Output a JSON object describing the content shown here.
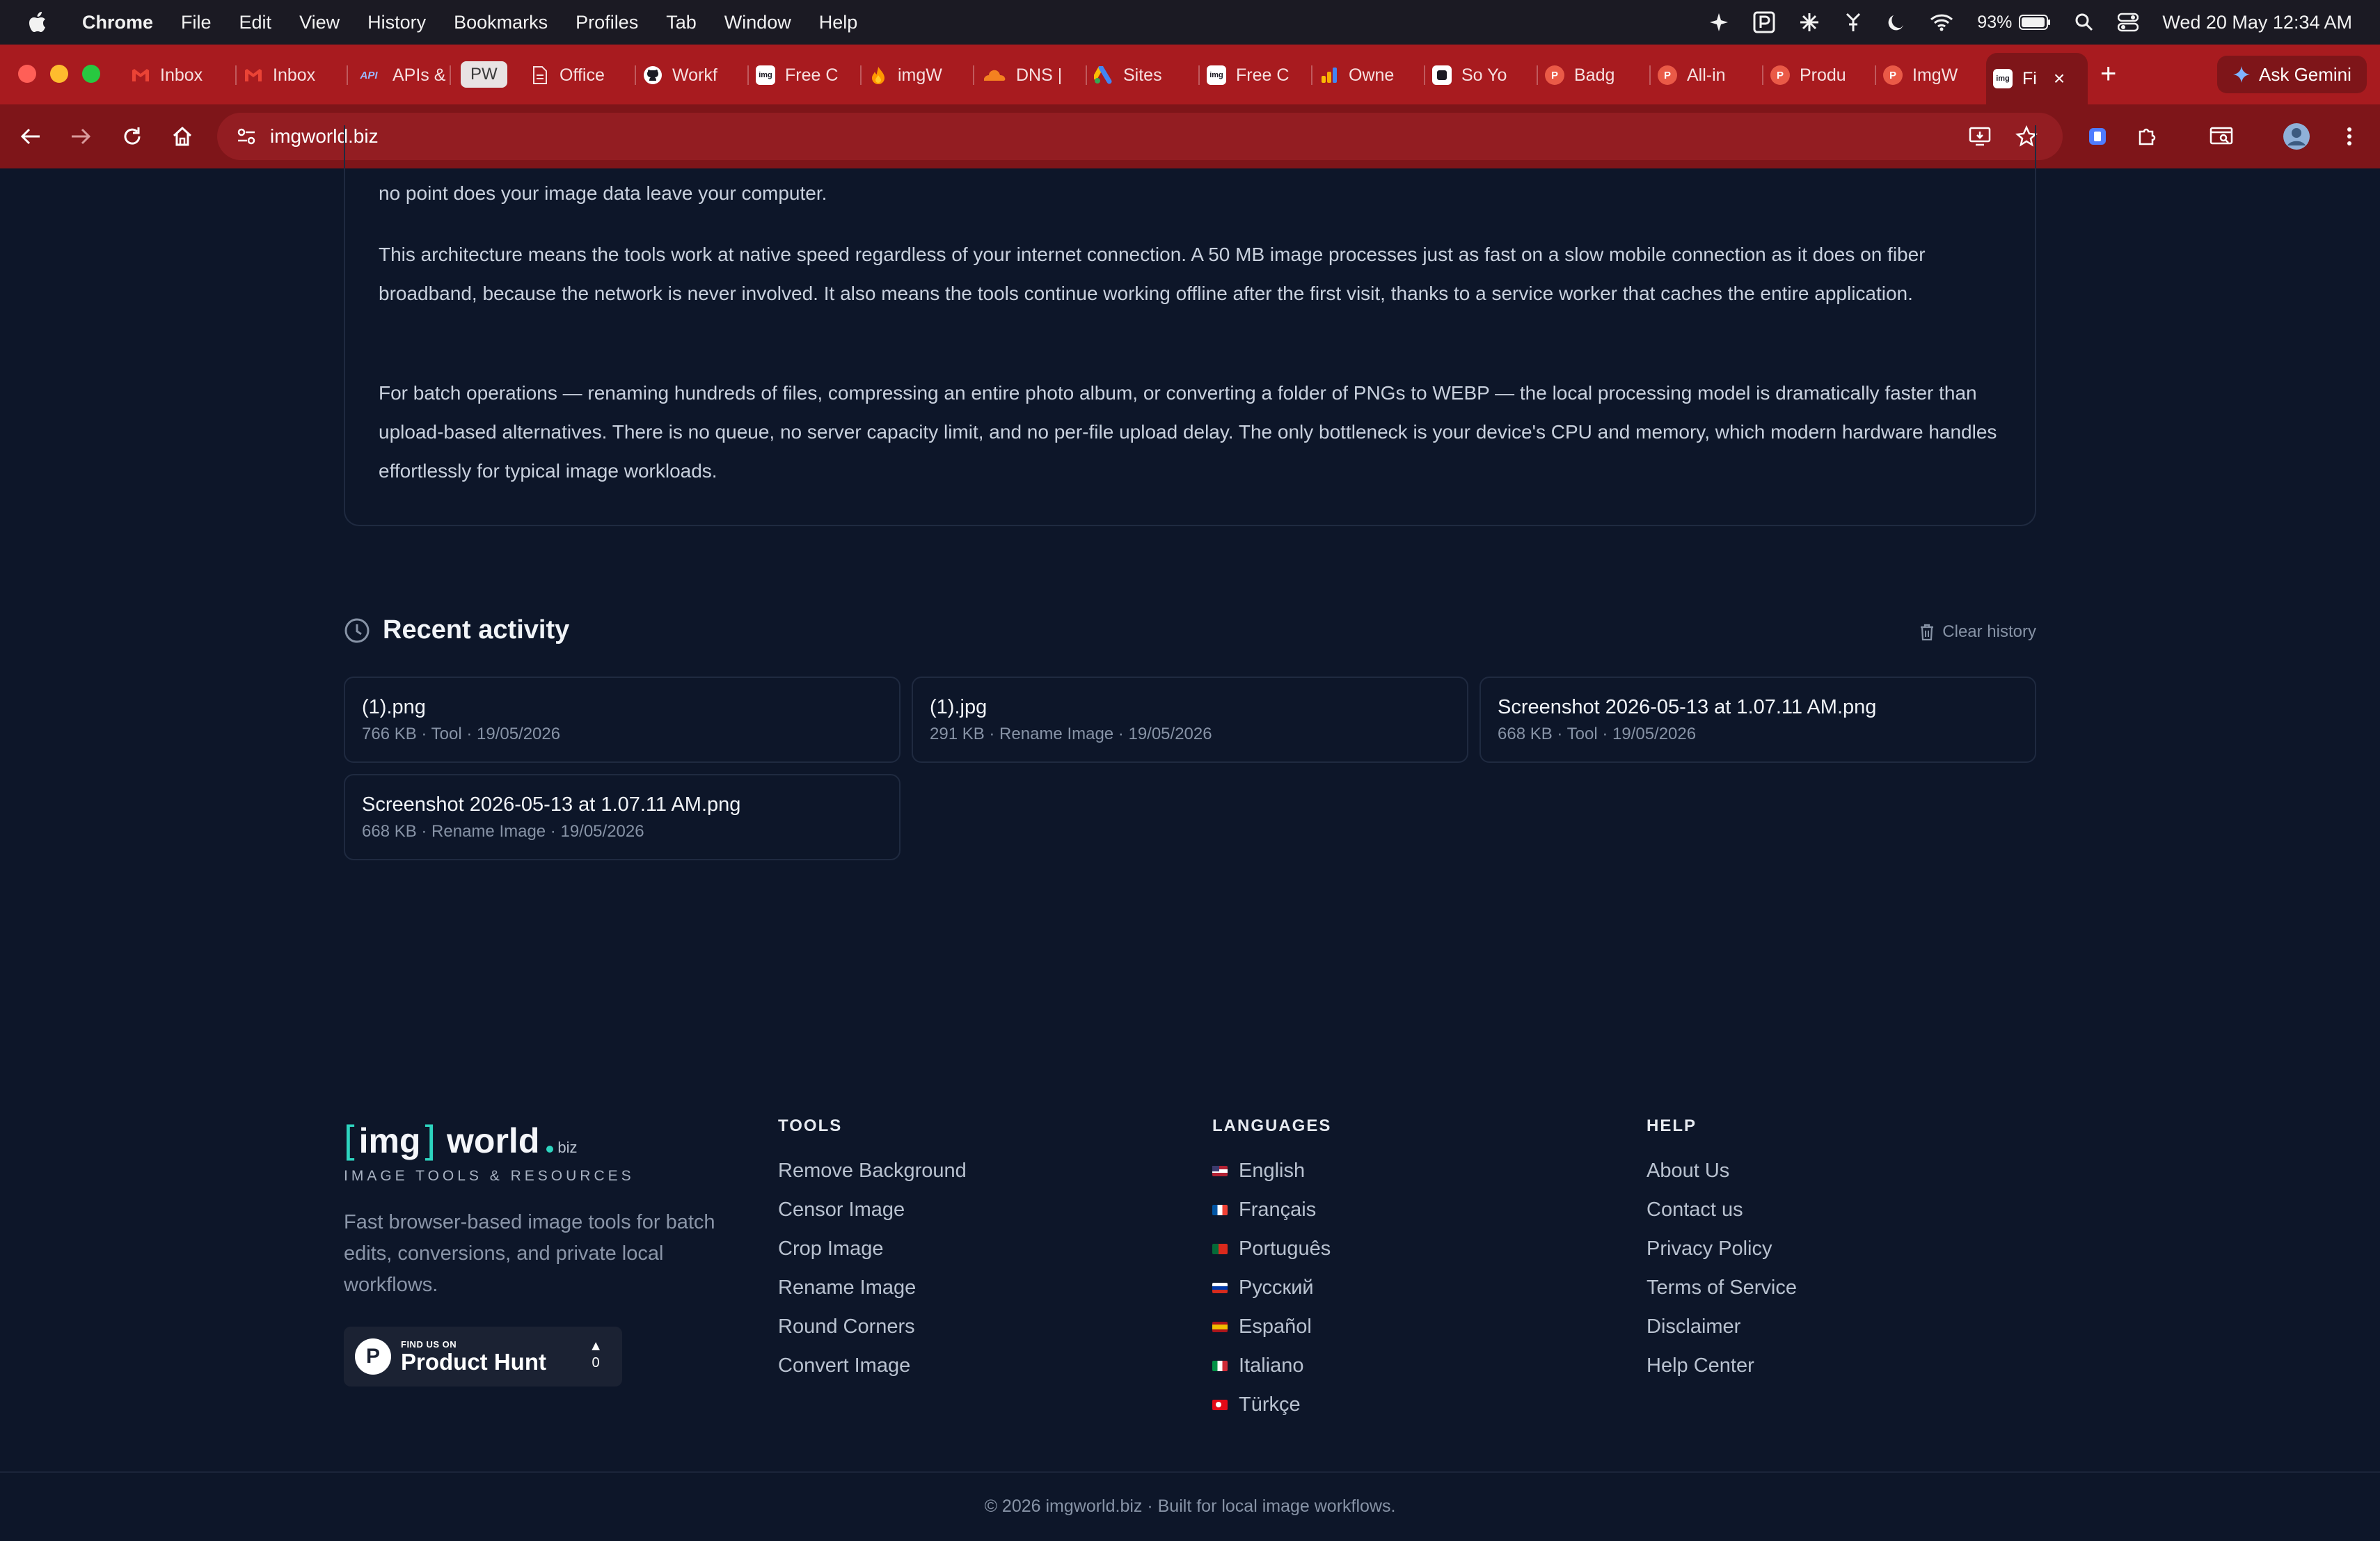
{
  "menubar": {
    "app": "Chrome",
    "items": [
      "File",
      "Edit",
      "View",
      "History",
      "Bookmarks",
      "Profiles",
      "Tab",
      "Window",
      "Help"
    ],
    "battery": "93%",
    "clock": "Wed 20 May  12:34 AM"
  },
  "tabs": [
    {
      "label": "Inbox",
      "icon": "gmail-icon"
    },
    {
      "label": "Inbox",
      "icon": "gmail-icon"
    },
    {
      "label": "APIs &",
      "icon": "api-icon"
    },
    {
      "label": "PW",
      "icon": "pw-badge"
    },
    {
      "label": "Office",
      "icon": "document-icon"
    },
    {
      "label": "Workf",
      "icon": "github-icon"
    },
    {
      "label": "Free C",
      "icon": "imgworld-icon"
    },
    {
      "label": "imgW",
      "icon": "firebase-icon"
    },
    {
      "label": "DNS |",
      "icon": "cloudflare-icon"
    },
    {
      "label": "Sites",
      "icon": "google-ads-icon"
    },
    {
      "label": "Free C",
      "icon": "imgworld-icon"
    },
    {
      "label": "Owne",
      "icon": "analytics-icon"
    },
    {
      "label": "So Yo",
      "icon": "app-icon"
    },
    {
      "label": "Badg",
      "icon": "producthunt-icon"
    },
    {
      "label": "All-in",
      "icon": "producthunt-icon"
    },
    {
      "label": "Produ",
      "icon": "producthunt-icon"
    },
    {
      "label": "ImgW",
      "icon": "producthunt-icon"
    },
    {
      "label": "Fi",
      "icon": "imgworld-icon",
      "active": true
    }
  ],
  "gemini_label": "Ask Gemini",
  "address": "imgworld.biz",
  "article": {
    "p0": "no point does your image data leave your computer.",
    "p1": "This architecture means the tools work at native speed regardless of your internet connection. A 50 MB image processes just as fast on a slow mobile connection as it does on fiber broadband, because the network is never involved. It also means the tools continue working offline after the first visit, thanks to a service worker that caches the entire application.",
    "p2": "For batch operations — renaming hundreds of files, compressing an entire photo album, or converting a folder of PNGs to WEBP — the local processing model is dramatically faster than upload-based alternatives. There is no queue, no server capacity limit, and no per-file upload delay. The only bottleneck is your device's CPU and memory, which modern hardware handles effortlessly for typical image workloads."
  },
  "recent": {
    "title": "Recent activity",
    "clear_label": "Clear history",
    "items": [
      {
        "name": "(1).png",
        "meta": "766 KB · Tool · 19/05/2026"
      },
      {
        "name": "(1).jpg",
        "meta": "291 KB · Rename Image · 19/05/2026"
      },
      {
        "name": "Screenshot 2026-05-13 at 1.07.11 AM.png",
        "meta": "668 KB · Tool · 19/05/2026"
      },
      {
        "name": "Screenshot 2026-05-13 at 1.07.11 AM.png",
        "meta": "668 KB · Rename Image · 19/05/2026"
      }
    ]
  },
  "footer": {
    "logo": {
      "bracket_left": "[",
      "img": "img",
      "bracket_right": "]",
      "world": "world",
      "biz": "biz"
    },
    "tagline": "IMAGE TOOLS & RESOURCES",
    "description": "Fast browser-based image tools for batch edits, conversions, and private local workflows.",
    "product_hunt": {
      "small": "FIND US ON",
      "big": "Product Hunt",
      "votes": "0"
    },
    "tools_title": "TOOLS",
    "tools": [
      "Remove Background",
      "Censor Image",
      "Crop Image",
      "Rename Image",
      "Round Corners",
      "Convert Image"
    ],
    "languages_title": "LANGUAGES",
    "languages": [
      {
        "label": "English",
        "flag": "us-flag-icon"
      },
      {
        "label": "Français",
        "flag": "fr-flag-icon"
      },
      {
        "label": "Português",
        "flag": "pt-flag-icon"
      },
      {
        "label": "Русский",
        "flag": "ru-flag-icon"
      },
      {
        "label": "Español",
        "flag": "es-flag-icon"
      },
      {
        "label": "Italiano",
        "flag": "it-flag-icon"
      },
      {
        "label": "Türkçe",
        "flag": "tr-flag-icon"
      }
    ],
    "help_title": "HELP",
    "help": [
      "About Us",
      "Contact us",
      "Privacy Policy",
      "Terms of Service",
      "Disclaimer",
      "Help Center"
    ],
    "copyright": "© 2026 imgworld.biz · Built for local image workflows."
  },
  "colors": {
    "page_bg": "#0d1629",
    "chrome_frame": "#a81b1f",
    "chrome_toolbar": "#7e1519",
    "accent": "#2dd4bf"
  }
}
